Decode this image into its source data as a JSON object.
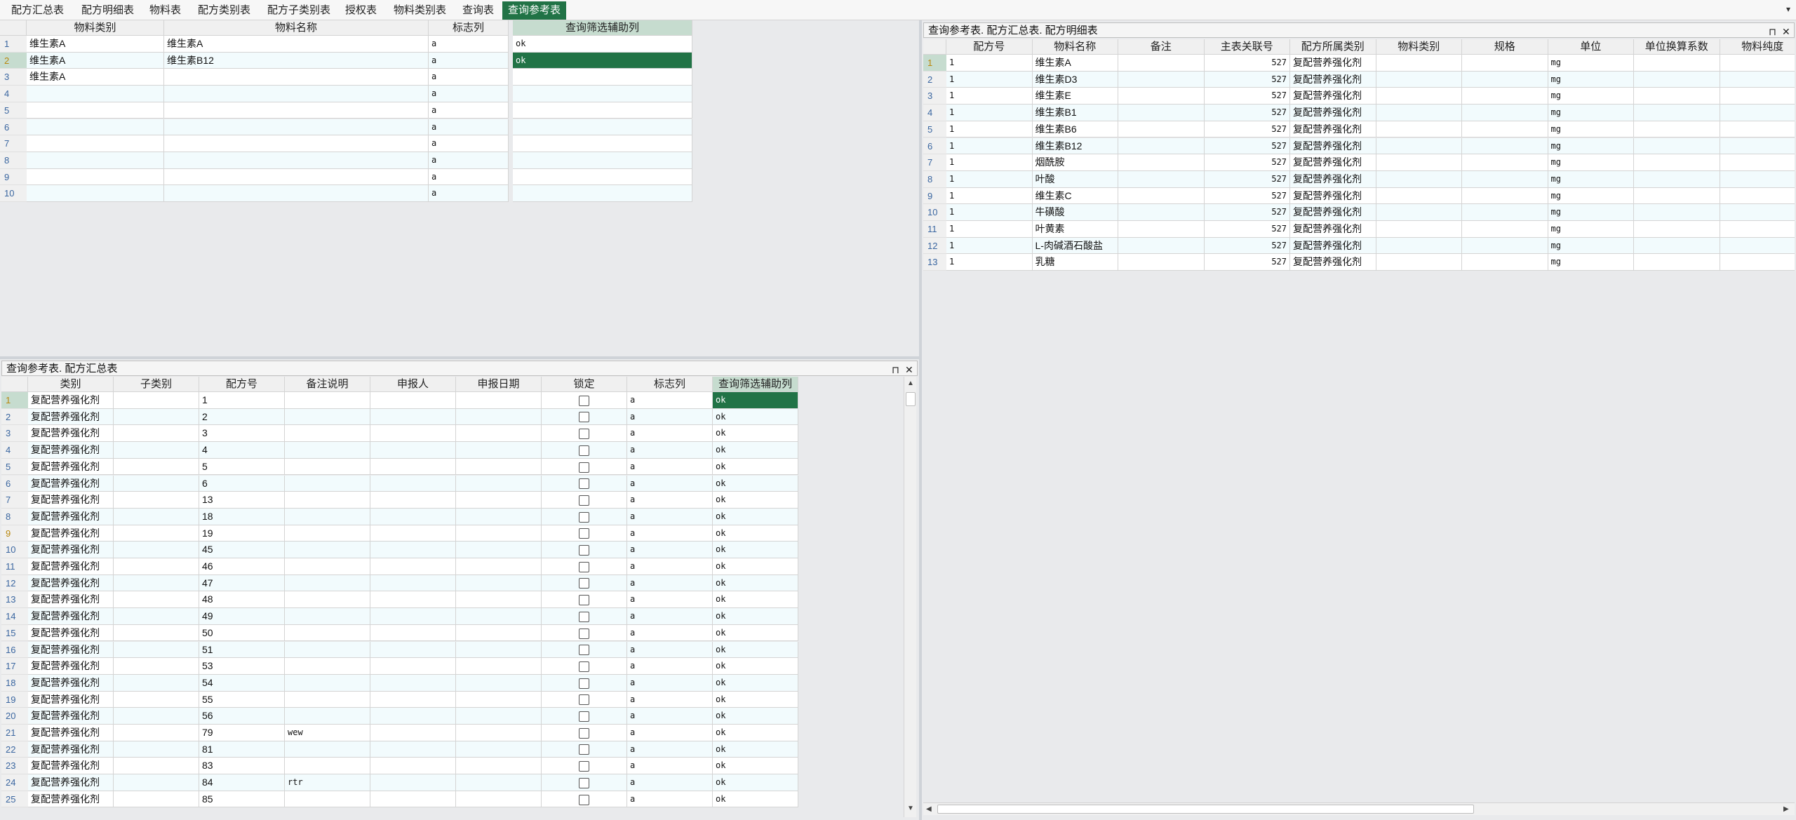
{
  "tabs": [
    {
      "label": "配方汇总表",
      "active": false
    },
    {
      "label": "配方明细表",
      "active": false
    },
    {
      "label": "物料表",
      "active": false
    },
    {
      "label": "配方类别表",
      "active": false
    },
    {
      "label": "配方子类别表",
      "active": false
    },
    {
      "label": "授权表",
      "active": false
    },
    {
      "label": "物料类别表",
      "active": false
    },
    {
      "label": "查询表",
      "active": false
    },
    {
      "label": "查询参考表",
      "active": true
    }
  ],
  "top_grid": {
    "headers": [
      "物料类别",
      "物料名称",
      "标志列",
      "查询筛选辅助列"
    ],
    "rows": [
      {
        "num": "1",
        "c": [
          "维生素A",
          "维生素A",
          "a",
          "ok"
        ]
      },
      {
        "num": "2",
        "c": [
          "维生素A",
          "维生素B12",
          "a",
          "ok"
        ]
      },
      {
        "num": "3",
        "c": [
          "维生素A",
          "",
          "a",
          ""
        ]
      },
      {
        "num": "4",
        "c": [
          "",
          "",
          "a",
          ""
        ]
      },
      {
        "num": "5",
        "c": [
          "",
          "",
          "a",
          ""
        ]
      },
      {
        "num": "6",
        "c": [
          "",
          "",
          "a",
          ""
        ]
      },
      {
        "num": "7",
        "c": [
          "",
          "",
          "a",
          ""
        ]
      },
      {
        "num": "8",
        "c": [
          "",
          "",
          "a",
          ""
        ]
      },
      {
        "num": "9",
        "c": [
          "",
          "",
          "a",
          ""
        ]
      },
      {
        "num": "10",
        "c": [
          "",
          "",
          "a",
          ""
        ]
      }
    ]
  },
  "bottom_panel": {
    "title": "查询参考表. 配方汇总表",
    "pin_icon": "⊓",
    "close_icon": "✕",
    "headers": [
      "类别",
      "子类别",
      "配方号",
      "备注说明",
      "申报人",
      "申报日期",
      "锁定",
      "标志列",
      "查询筛选辅助列"
    ],
    "rows": [
      {
        "num": "1",
        "cat": "复配营养强化剂",
        "id": "1",
        "note": "",
        "flag": "a",
        "aux": "ok"
      },
      {
        "num": "2",
        "cat": "复配营养强化剂",
        "id": "2",
        "note": "",
        "flag": "a",
        "aux": "ok"
      },
      {
        "num": "3",
        "cat": "复配营养强化剂",
        "id": "3",
        "note": "",
        "flag": "a",
        "aux": "ok"
      },
      {
        "num": "4",
        "cat": "复配营养强化剂",
        "id": "4",
        "note": "",
        "flag": "a",
        "aux": "ok"
      },
      {
        "num": "5",
        "cat": "复配营养强化剂",
        "id": "5",
        "note": "",
        "flag": "a",
        "aux": "ok"
      },
      {
        "num": "6",
        "cat": "复配营养强化剂",
        "id": "6",
        "note": "",
        "flag": "a",
        "aux": "ok"
      },
      {
        "num": "7",
        "cat": "复配营养强化剂",
        "id": "13",
        "note": "",
        "flag": "a",
        "aux": "ok"
      },
      {
        "num": "8",
        "cat": "复配营养强化剂",
        "id": "18",
        "note": "",
        "flag": "a",
        "aux": "ok"
      },
      {
        "num": "9",
        "cat": "复配营养强化剂",
        "id": "19",
        "note": "",
        "flag": "a",
        "aux": "ok"
      },
      {
        "num": "10",
        "cat": "复配营养强化剂",
        "id": "45",
        "note": "",
        "flag": "a",
        "aux": "ok"
      },
      {
        "num": "11",
        "cat": "复配营养强化剂",
        "id": "46",
        "note": "",
        "flag": "a",
        "aux": "ok"
      },
      {
        "num": "12",
        "cat": "复配营养强化剂",
        "id": "47",
        "note": "",
        "flag": "a",
        "aux": "ok"
      },
      {
        "num": "13",
        "cat": "复配营养强化剂",
        "id": "48",
        "note": "",
        "flag": "a",
        "aux": "ok"
      },
      {
        "num": "14",
        "cat": "复配营养强化剂",
        "id": "49",
        "note": "",
        "flag": "a",
        "aux": "ok"
      },
      {
        "num": "15",
        "cat": "复配营养强化剂",
        "id": "50",
        "note": "",
        "flag": "a",
        "aux": "ok"
      },
      {
        "num": "16",
        "cat": "复配营养强化剂",
        "id": "51",
        "note": "",
        "flag": "a",
        "aux": "ok"
      },
      {
        "num": "17",
        "cat": "复配营养强化剂",
        "id": "53",
        "note": "",
        "flag": "a",
        "aux": "ok"
      },
      {
        "num": "18",
        "cat": "复配营养强化剂",
        "id": "54",
        "note": "",
        "flag": "a",
        "aux": "ok"
      },
      {
        "num": "19",
        "cat": "复配营养强化剂",
        "id": "55",
        "note": "",
        "flag": "a",
        "aux": "ok"
      },
      {
        "num": "20",
        "cat": "复配营养强化剂",
        "id": "56",
        "note": "",
        "flag": "a",
        "aux": "ok"
      },
      {
        "num": "21",
        "cat": "复配营养强化剂",
        "id": "79",
        "note": "wew",
        "flag": "a",
        "aux": "ok"
      },
      {
        "num": "22",
        "cat": "复配营养强化剂",
        "id": "81",
        "note": "",
        "flag": "a",
        "aux": "ok"
      },
      {
        "num": "23",
        "cat": "复配营养强化剂",
        "id": "83",
        "note": "",
        "flag": "a",
        "aux": "ok"
      },
      {
        "num": "24",
        "cat": "复配营养强化剂",
        "id": "84",
        "note": "rtr",
        "flag": "a",
        "aux": "ok"
      },
      {
        "num": "25",
        "cat": "复配营养强化剂",
        "id": "85",
        "note": "",
        "flag": "a",
        "aux": "ok"
      }
    ]
  },
  "right_panel": {
    "title": "查询参考表. 配方汇总表. 配方明细表",
    "pin_icon": "⊓",
    "close_icon": "✕",
    "headers": [
      "配方号",
      "物料名称",
      "备注",
      "主表关联号",
      "配方所属类别",
      "物料类别",
      "规格",
      "单位",
      "单位换算系数",
      "物料纯度"
    ],
    "rows": [
      {
        "num": "1",
        "id": "1",
        "name": "维生素A",
        "link": "527",
        "cat": "复配营养强化剂",
        "unit": "mg"
      },
      {
        "num": "2",
        "id": "1",
        "name": "维生素D3",
        "link": "527",
        "cat": "复配营养强化剂",
        "unit": "mg"
      },
      {
        "num": "3",
        "id": "1",
        "name": "维生素E",
        "link": "527",
        "cat": "复配营养强化剂",
        "unit": "mg"
      },
      {
        "num": "4",
        "id": "1",
        "name": "维生素B1",
        "link": "527",
        "cat": "复配营养强化剂",
        "unit": "mg"
      },
      {
        "num": "5",
        "id": "1",
        "name": "维生素B6",
        "link": "527",
        "cat": "复配营养强化剂",
        "unit": "mg"
      },
      {
        "num": "6",
        "id": "1",
        "name": "维生素B12",
        "link": "527",
        "cat": "复配营养强化剂",
        "unit": "mg"
      },
      {
        "num": "7",
        "id": "1",
        "name": "烟酰胺",
        "link": "527",
        "cat": "复配营养强化剂",
        "unit": "mg"
      },
      {
        "num": "8",
        "id": "1",
        "name": "叶酸",
        "link": "527",
        "cat": "复配营养强化剂",
        "unit": "mg"
      },
      {
        "num": "9",
        "id": "1",
        "name": "维生素C",
        "link": "527",
        "cat": "复配营养强化剂",
        "unit": "mg"
      },
      {
        "num": "10",
        "id": "1",
        "name": "牛磺酸",
        "link": "527",
        "cat": "复配营养强化剂",
        "unit": "mg"
      },
      {
        "num": "11",
        "id": "1",
        "name": "叶黄素",
        "link": "527",
        "cat": "复配营养强化剂",
        "unit": "mg"
      },
      {
        "num": "12",
        "id": "1",
        "name": "L-肉碱酒石酸盐",
        "link": "527",
        "cat": "复配营养强化剂",
        "unit": "mg"
      },
      {
        "num": "13",
        "id": "1",
        "name": "乳糖",
        "link": "527",
        "cat": "复配营养强化剂",
        "unit": "mg"
      }
    ]
  },
  "icons": {
    "scroll_up": "▲",
    "scroll_down": "▼",
    "scroll_left": "◀",
    "scroll_right": "▶",
    "tab_menu": "▾"
  },
  "colors": {
    "accent": "#217346",
    "header_bg": "#f0f0f0",
    "selected_header": "#c6dccf",
    "row_num": "#3a66a0"
  }
}
